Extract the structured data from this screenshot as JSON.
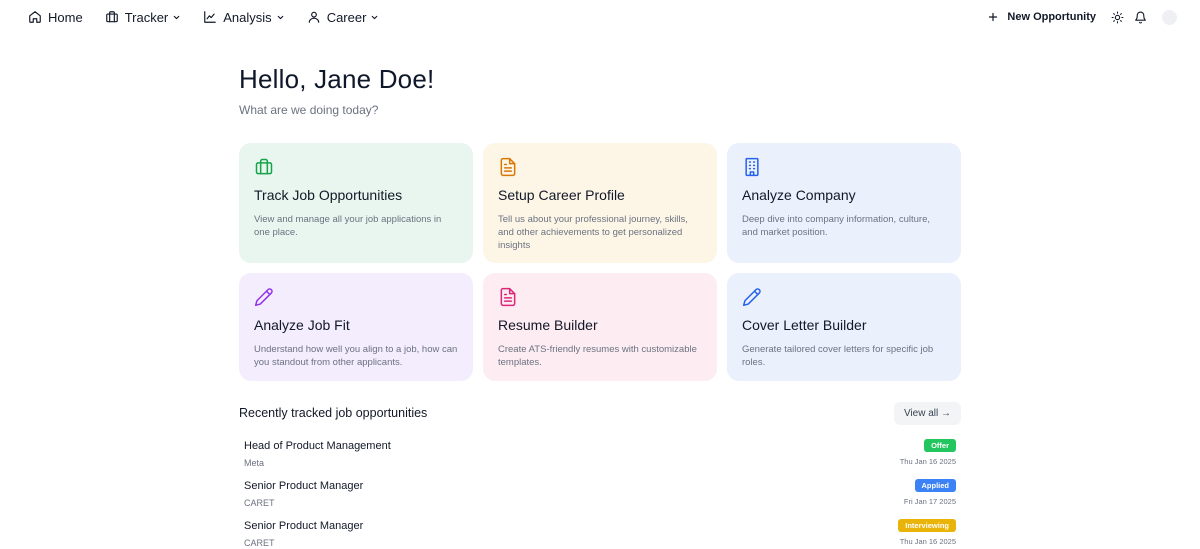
{
  "nav": {
    "items": [
      {
        "label": "Home",
        "icon": "home-icon",
        "dropdown": false
      },
      {
        "label": "Tracker",
        "icon": "briefcase-icon",
        "dropdown": true
      },
      {
        "label": "Analysis",
        "icon": "chart-line-icon",
        "dropdown": true
      },
      {
        "label": "Career",
        "icon": "user-icon",
        "dropdown": true
      }
    ],
    "new_opportunity_label": "New Opportunity"
  },
  "greeting": {
    "title": "Hello, Jane Doe!",
    "subtitle": "What are we doing today?"
  },
  "cards": [
    {
      "title": "Track Job Opportunities",
      "desc": "View and manage all your job applications in one place.",
      "icon": "briefcase-icon",
      "bg": "#e8f6ef",
      "accent": "#16a34a"
    },
    {
      "title": "Setup Career Profile",
      "desc": "Tell us about your professional journey, skills, and other achievements to get personalized insights",
      "icon": "document-icon",
      "bg": "#fdf6e7",
      "accent": "#d97706"
    },
    {
      "title": "Analyze Company",
      "desc": "Deep dive into company information, culture, and market position.",
      "icon": "building-icon",
      "bg": "#ebf0fd",
      "accent": "#2563eb"
    },
    {
      "title": "Analyze Job Fit",
      "desc": "Understand how well you align to a job, how can you standout from other applicants.",
      "icon": "pencil-icon",
      "bg": "#f4edfd",
      "accent": "#9333ea"
    },
    {
      "title": "Resume Builder",
      "desc": "Create ATS-friendly resumes with customizable templates.",
      "icon": "document-icon",
      "bg": "#fdedf3",
      "accent": "#db2777"
    },
    {
      "title": "Cover Letter Builder",
      "desc": "Generate tailored cover letters for specific job roles.",
      "icon": "pencil-icon",
      "bg": "#ebf0fd",
      "accent": "#2563eb"
    }
  ],
  "recent": {
    "title": "Recently tracked job opportunities",
    "view_all_label": "View all →",
    "rows": [
      {
        "title": "Head of Product Management",
        "company": "Meta",
        "status": "Offer",
        "status_color": "#22c55e",
        "date": "Thu Jan 16 2025"
      },
      {
        "title": "Senior Product Manager",
        "company": "CARET",
        "status": "Applied",
        "status_color": "#3b82f6",
        "date": "Fri Jan 17 2025"
      },
      {
        "title": "Senior Product Manager",
        "company": "CARET",
        "status": "Interviewing",
        "status_color": "#eab308",
        "date": "Thu Jan 16 2025"
      }
    ]
  }
}
